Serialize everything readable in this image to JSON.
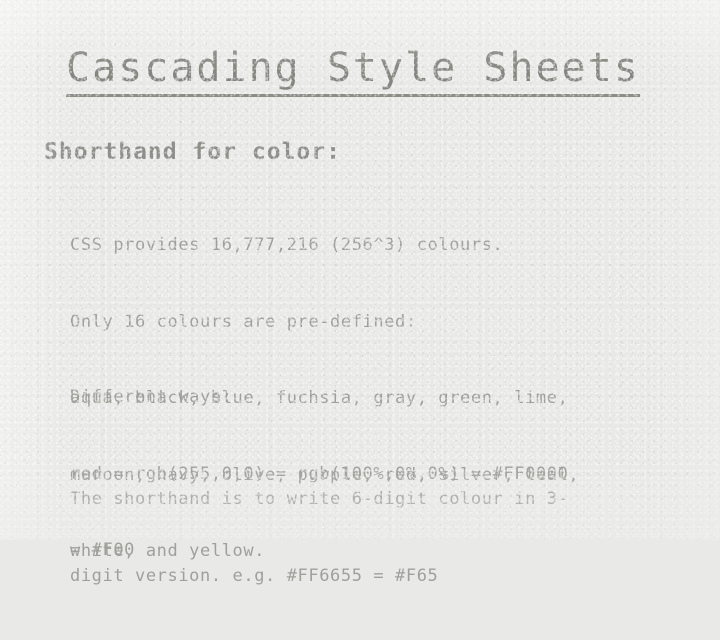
{
  "slide": {
    "title": "Cascading Style Sheets",
    "section_heading": "Shorthand for color:",
    "title_color": "#85857f",
    "heading_color": "#8f8f8a",
    "body_color": "#a0a09b",
    "background_color": "#e9e9e7",
    "paragraphs": [
      {
        "name": "colour-list",
        "lines": [
          "CSS provides 16,777,216 (256^3) colours.",
          "Only 16 colours are pre-defined:",
          "aqua, black, blue, fuchsia, gray, green, lime,",
          "maroon, navy, olive, purple, red, silver, teal,",
          "white, and yellow."
        ]
      },
      {
        "name": "different-ways",
        "lines": [
          "Different ways:",
          "red = rgb(255,0,0) = rgb(100%,0%,0%) = #FF0000",
          "= #F00"
        ]
      },
      {
        "name": "shorthand-rule",
        "lines": [
          "The shorthand is to write 6-digit colour in 3-",
          "digit version. e.g. #FF6655 = #F65"
        ]
      }
    ]
  }
}
